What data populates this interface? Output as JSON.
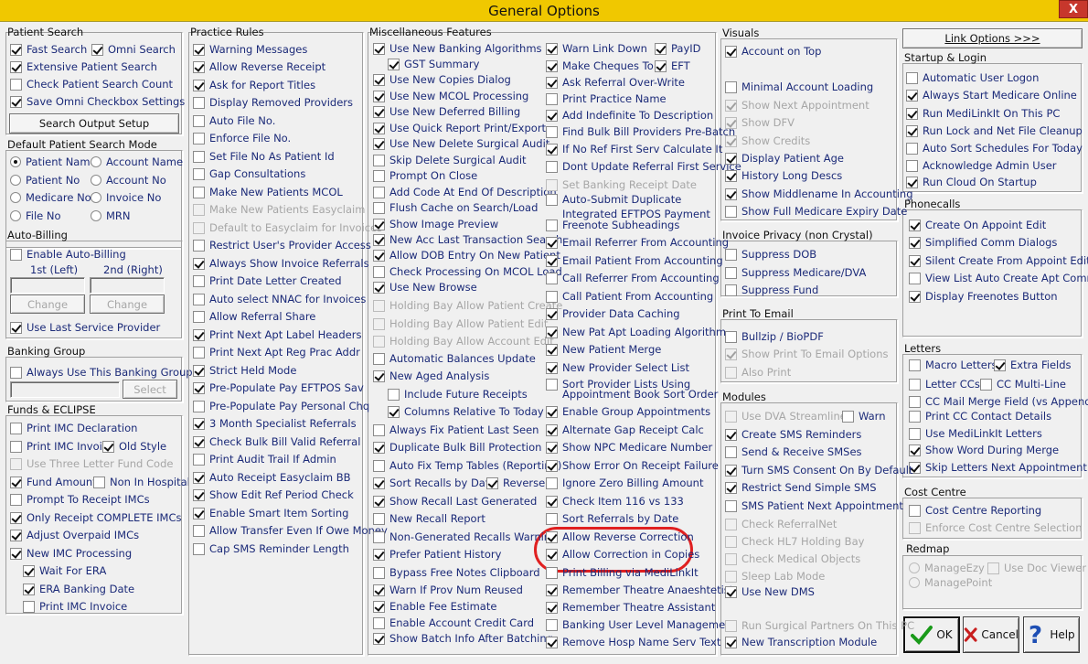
{
  "window": {
    "title": "General Options",
    "close_glyph": "X"
  },
  "patient_search": {
    "title": "Patient Search",
    "items": [
      {
        "label": "Fast Search",
        "checked": true
      },
      {
        "label": "Omni Search",
        "checked": true
      },
      {
        "label": "Extensive Patient Search",
        "checked": true
      },
      {
        "label": "Check Patient Search Count",
        "checked": false
      },
      {
        "label": "Save Omni Checkbox Settings",
        "checked": true
      }
    ],
    "button": "Search Output Setup"
  },
  "default_search_mode": {
    "title": "Default Patient Search Mode",
    "options": [
      "Patient Name",
      "Account Name",
      "Patient No",
      "Account No",
      "Medicare No",
      "Invoice No",
      "File No",
      "MRN"
    ],
    "selected": "Patient Name"
  },
  "auto_billing": {
    "title": "Auto-Billing",
    "enable": "Enable Auto-Billing",
    "first_label": "1st (Left)",
    "second_label": "2nd (Right)",
    "change1": "Change",
    "change2": "Change",
    "last_provider": "Use Last Service Provider"
  },
  "banking_group": {
    "title": "Banking Group",
    "always": "Always Use This Banking Group",
    "select": "Select"
  },
  "funds": {
    "title": "Funds & ECLIPSE",
    "items": [
      "Print IMC Declaration",
      "Print IMC Invoice",
      "Old Style",
      "Use Three Letter Fund Code",
      "Fund Amount",
      "Non In Hospital",
      "Prompt To Receipt IMCs",
      "Only Receipt COMPLETE IMCs",
      "Adjust Overpaid IMCs",
      "New IMC Processing",
      "Wait For ERA",
      "ERA Banking Date",
      "Print IMC Invoice"
    ]
  },
  "practice_rules": {
    "title": "Practice Rules",
    "items": [
      "Warning Messages",
      "Allow Reverse Receipt",
      "Ask for Report Titles",
      "Display Removed Providers",
      "Auto File No.",
      "Enforce File No.",
      "Set File No As Patient Id",
      "Gap Consultations",
      "Make New Patients MCOL",
      "Make New Patients Easyclaim",
      "Default to Easyclaim for Invoices",
      "Restrict User's Provider Access",
      "Always Show Invoice Referrals",
      "Print Date Letter Created",
      "Auto select NNAC for Invoices",
      "Allow Referral Share",
      "Print Next Apt Label Headers",
      "Print Next Apt Reg Prac Addr",
      "Strict Held Mode",
      "Pre-Populate Pay EFTPOS Sav",
      "Pre-Populate Pay Personal Chq",
      "3 Month Specialist Referrals",
      "Check Bulk Bill Valid Referral",
      "Print Audit Trail If Admin",
      "Auto Receipt Easyclaim BB",
      "Show Edit Ref Period Check",
      "Enable Smart Item Sorting",
      "Allow Transfer Even If Owe Money",
      "Cap SMS Reminder Length"
    ]
  },
  "misc": {
    "title": "Miscellaneous Features",
    "col1": [
      "Use New Banking Algorithms",
      "GST Summary",
      "Use New Copies Dialog",
      "Use New MCOL Processing",
      "Use New Deferred Billing",
      "Use Quick Report Print/Export",
      "Use New Delete Surgical Audit",
      "Skip Delete Surgical Audit",
      "Prompt On Close",
      "Add Code At End Of Description",
      "Flush Cache on Search/Load",
      "Show Image Preview",
      "New Acc Last Transaction Search",
      "Allow DOB Entry On New Patient",
      "Check Processing On MCOL Load",
      "Use New Browse",
      "Holding Bay Allow Patient Create",
      "Holding Bay Allow Patient Edit",
      "Holding Bay Allow Account Edit",
      "Automatic Balances Update",
      "New Aged Analysis",
      "Include Future Receipts",
      "Columns Relative To Today",
      "Always Fix Patient Last Seen",
      "Duplicate Bulk Bill Protection",
      "Auto Fix Temp Tables (Reporting)",
      "Sort Recalls by Date",
      "Reverse",
      "Show Recall Last Generated",
      "New Recall Report",
      "Non-Generated Recalls Warning",
      "Prefer Patient History",
      "Bypass Free Notes Clipboard",
      "Warn If Prov Num Reused",
      "Enable Fee Estimate",
      "Enable Account Credit Card",
      "Show Batch Info After Batching"
    ],
    "col2": [
      "Warn Link Down",
      "PayID",
      "Make Cheques To",
      "EFT",
      "Ask Referral Over-Write",
      "Print Practice Name",
      "Add Indefinite To Description",
      "Find Bulk Bill Providers Pre-Batch",
      "If No Ref First Serv Calculate It",
      "Dont Update Referral First Service",
      "Set Banking Receipt Date",
      "Auto-Submit Duplicate",
      "Integrated EFTPOS Payment",
      "Freenote Subheadings",
      "Email Referrer From Accounting",
      "Email Patient From Accounting",
      "Call Referrer From Accounting",
      "Call Patient From Accounting",
      "Provider Data Caching",
      "New Pat Apt Loading Algorithm",
      "New Patient Merge",
      "New Provider Select List",
      "Sort Provider Lists Using",
      "Appointment Book Sort Order",
      "Enable Group Appointments",
      "Alternate Gap Receipt Calc",
      "Show NPC Medicare Number",
      "Show Error On Receipt Failure",
      "Ignore Zero Billing Amount",
      "Check Item 116 vs 133",
      "Sort Referrals by Date",
      "Allow Reverse Correction",
      "Allow Correction in Copies",
      "Print Billing via MediLinkIt",
      "Remember Theatre Anaeshtetist",
      "Remember Theatre Assistant",
      "Banking User Level Management",
      "Remove Hosp Name Serv Text"
    ]
  },
  "visuals": {
    "title": "Visuals",
    "items": [
      "Account on Top",
      "Minimal Account Loading",
      "Show Next Appointment",
      "Show DFV",
      "Show Credits",
      "Display Patient Age",
      "History Long Descs",
      "Show Middlename In Accounting",
      "Show Full Medicare Expiry Date"
    ]
  },
  "invoice_privacy": {
    "title": "Invoice Privacy (non Crystal)",
    "items": [
      "Suppress DOB",
      "Suppress Medicare/DVA",
      "Suppress Fund"
    ]
  },
  "print_email": {
    "title": "Print To Email",
    "items": [
      "Bullzip / BioPDF",
      "Show Print To Email Options",
      "Also Print"
    ]
  },
  "modules": {
    "title": "Modules",
    "items": [
      "Use DVA Streamlined",
      "Warn",
      "Create SMS Reminders",
      "Send & Receive SMSes",
      "Turn SMS Consent On By Default",
      "Restrict Send Simple SMS",
      "SMS Patient Next Appointment",
      "Check ReferralNet",
      "Check HL7 Holding Bay",
      "Check Medical Objects",
      "Sleep Lab Mode",
      "Use New DMS",
      "Run Surgical Partners On This PC",
      "New Transcription Module"
    ]
  },
  "link_options": "Link Options >>>",
  "startup": {
    "title": "Startup & Login",
    "items": [
      "Automatic User Logon",
      "Always Start Medicare Online",
      "Run MediLinkIt On This PC",
      "Run Lock and Net File Cleanup",
      "Auto Sort Schedules For Today",
      "Acknowledge Admin User",
      "Run Cloud On Startup"
    ]
  },
  "phonecalls": {
    "title": "Phonecalls",
    "items": [
      "Create On Appoint Edit",
      "Simplified Comm Dialogs",
      "Silent Create From Appoint Edit",
      "View List Auto Create Apt Comms",
      "Display Freenotes Button"
    ]
  },
  "letters": {
    "title": "Letters",
    "items": [
      "Macro Letters",
      "Extra Fields",
      "Letter CCs",
      "CC Multi-Line",
      "CC Mail Merge Field (vs Append)",
      "Print CC Contact Details",
      "Use MediLinkIt Letters",
      "Show Word During Merge",
      "Skip Letters Next Appointment"
    ]
  },
  "cost_centre": {
    "title": "Cost Centre",
    "items": [
      "Cost Centre Reporting",
      "Enforce Cost Centre Selection"
    ]
  },
  "redmap": {
    "title": "Redmap",
    "items": [
      "ManageEzy",
      "Use Doc Viewer",
      "ManagePoint"
    ]
  },
  "footer": {
    "ok": "OK",
    "cancel": "Cancel",
    "help": "Help"
  },
  "colors": {
    "title_bar": "#f0c800",
    "label_text": "#1b2a78",
    "highlight_circle": "#e02020"
  }
}
